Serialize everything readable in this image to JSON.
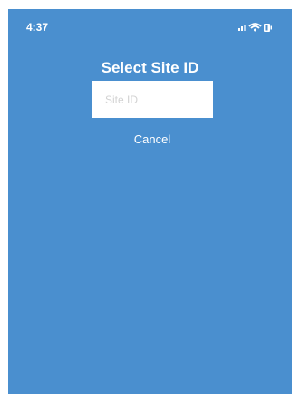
{
  "status_bar": {
    "time": "4:37",
    "icons": [
      "signal-icon",
      "wifi-icon",
      "battery-icon"
    ]
  },
  "dialog": {
    "title": "Select Site ID",
    "input_placeholder": "Site ID",
    "input_value": "",
    "cancel_label": "Cancel"
  },
  "colors": {
    "background": "#4a8fcf",
    "text": "#ffffff",
    "input_background": "#ffffff",
    "placeholder": "#d2d2d2"
  }
}
